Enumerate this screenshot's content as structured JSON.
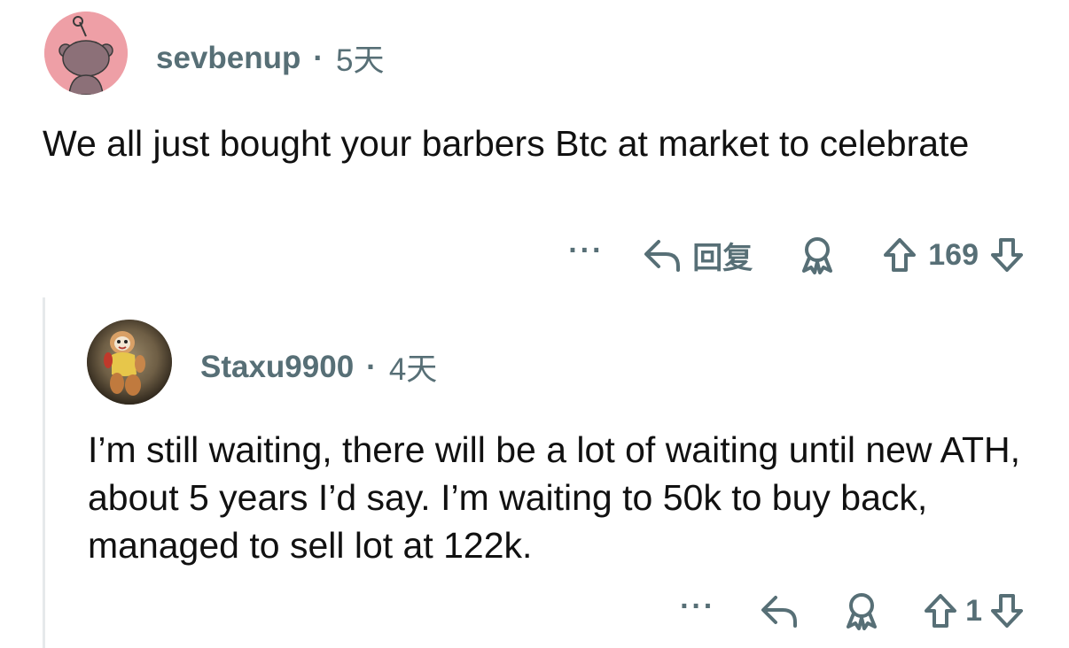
{
  "comment": {
    "username": "sevbenup",
    "separator": "·",
    "age": "5天",
    "body": "We all just bought your barbers Btc at market to celebrate",
    "actions": {
      "more": "···",
      "reply_label": "回复",
      "score": "169"
    },
    "avatar_color": "#ee9fa6"
  },
  "reply": {
    "username": "Staxu9900",
    "separator": "·",
    "age": "4天",
    "body": "I’m still waiting, there will be a lot of waiting until new ATH, about 5 years I’d say. I’m waiting to 50k to buy back, managed to sell lot at 122k.",
    "actions": {
      "more": "···",
      "score": "1"
    }
  },
  "colors": {
    "meta_text": "#576f76",
    "body_text": "#111111",
    "thread_line": "#e6e9eb"
  },
  "icons": {
    "reply": "reply-arrow-icon",
    "award": "award-icon",
    "upvote": "upvote-arrow-icon",
    "downvote": "downvote-arrow-icon",
    "more": "more-options-icon"
  }
}
